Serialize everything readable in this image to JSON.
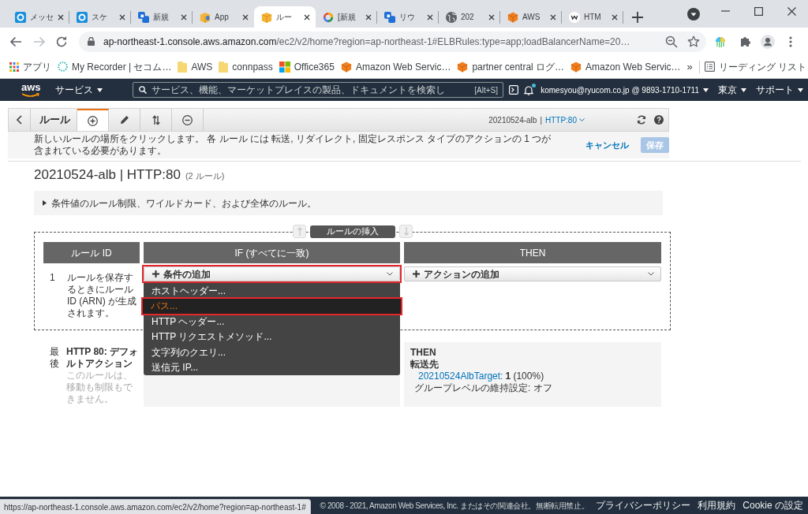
{
  "tabs": [
    {
      "title": "メッセ",
      "selected": false
    },
    {
      "title": "スケ",
      "selected": false
    },
    {
      "title": "新規",
      "selected": false
    },
    {
      "title": "App",
      "selected": false
    },
    {
      "title": "ルー",
      "selected": true
    },
    {
      "title": "[新規",
      "selected": false
    },
    {
      "title": "リウ",
      "selected": false
    },
    {
      "title": "202",
      "selected": false
    },
    {
      "title": "AWS",
      "selected": false
    },
    {
      "title": "HTM",
      "selected": false
    }
  ],
  "address_bar": {
    "host": "ap-northeast-1.console.aws.amazon.com",
    "path": "/ec2/v2/home?region=ap-northeast-1#ELBRules:type=app;loadBalancerName=20…"
  },
  "bookmarks": [
    {
      "label": "アプリ"
    },
    {
      "label": "My Recorder | セコム…"
    },
    {
      "label": "AWS"
    },
    {
      "label": "connpass"
    },
    {
      "label": "Office365"
    },
    {
      "label": "Amazon Web Servic…"
    },
    {
      "label": "partner central ログ…"
    },
    {
      "label": "Amazon Web Servic…"
    }
  ],
  "bookmarks_more": "»",
  "reading_list": "リーディング リスト",
  "aws_nav": {
    "logo": "aws",
    "services": "サービス",
    "search": {
      "placeholder": "サービス、機能、マーケットプレイスの製品、ドキュメントを検索し",
      "shortcut": "[Alt+S]"
    },
    "notification": true,
    "account": "komesyou@ryucom.co.jp @ 9893-1710-1711",
    "region": "東京",
    "support": "サポート"
  },
  "toolbar": {
    "title": "ルール",
    "tools": [
      {
        "selected": true
      },
      {
        "selected": false
      },
      {
        "selected": false
      },
      {
        "selected": false
      }
    ],
    "load_balancer": "20210524-alb",
    "separator": "|",
    "listener": "HTTP:80"
  },
  "notice": {
    "text": "新しいルールの場所をクリックします。 各 ルール には 転送, リダイレクト, 固定レスポンス タイプのアクションの 1 つが含まれている必要があります。",
    "cancel": "キャンセル",
    "save": {
      "label": "保存",
      "disabled": true
    }
  },
  "listener": {
    "title": "20210524-alb | HTTP:80",
    "rule_count": "(2 ルール)"
  },
  "info": {
    "text": "条件値のルール制限、ワイルドカード、および全体のルール。",
    "expanded": false
  },
  "insert": {
    "label": "ルールの挿入",
    "up_disabled": true,
    "down_disabled": true
  },
  "columns": [
    "ルール ID",
    "IF (すべてに一致)",
    "THEN"
  ],
  "rules": [
    {
      "kind": "new",
      "number": "1",
      "note": "ルールを保存するときにルール ID (ARN) が生成されます。",
      "condition": {
        "label": "条件の追加",
        "annotated": true,
        "open": true,
        "options": [
          {
            "label": "ホストヘッダー...",
            "selected": false,
            "annotated": false
          },
          {
            "label": "パス...",
            "selected": true,
            "annotated": true
          },
          {
            "label": "HTTP ヘッダー...",
            "selected": false,
            "annotated": false
          },
          {
            "label": "HTTP リクエストメソッド...",
            "selected": false,
            "annotated": false
          },
          {
            "label": "文字列のクエリ...",
            "selected": false,
            "annotated": false
          },
          {
            "label": "送信元 IP...",
            "selected": false,
            "annotated": false
          }
        ]
      },
      "action": {
        "label": "アクションの追加",
        "annotated": false
      }
    },
    {
      "kind": "default",
      "number": "最後",
      "title": "HTTP 80: デフォルトアクション",
      "note": "このルールは、移動も制限もできません。",
      "then": {
        "heading": "THEN",
        "action": "転送先",
        "target": "20210524AlbTarget:",
        "weight": "1",
        "share": "(100%)",
        "stickiness": "グループレベルの維持設定: オフ"
      }
    }
  ],
  "status_url": "https://ap-northeast-1.console.aws.amazon.com/ec2/v2/home?region=ap-northeast-1#",
  "footer": {
    "copyright": "© 2008 - 2021, Amazon Web Services, Inc. またはその関連会社。無断転用禁止。",
    "links": [
      "プライバシーポリシー",
      "利用規約",
      "Cookie の設定"
    ]
  }
}
